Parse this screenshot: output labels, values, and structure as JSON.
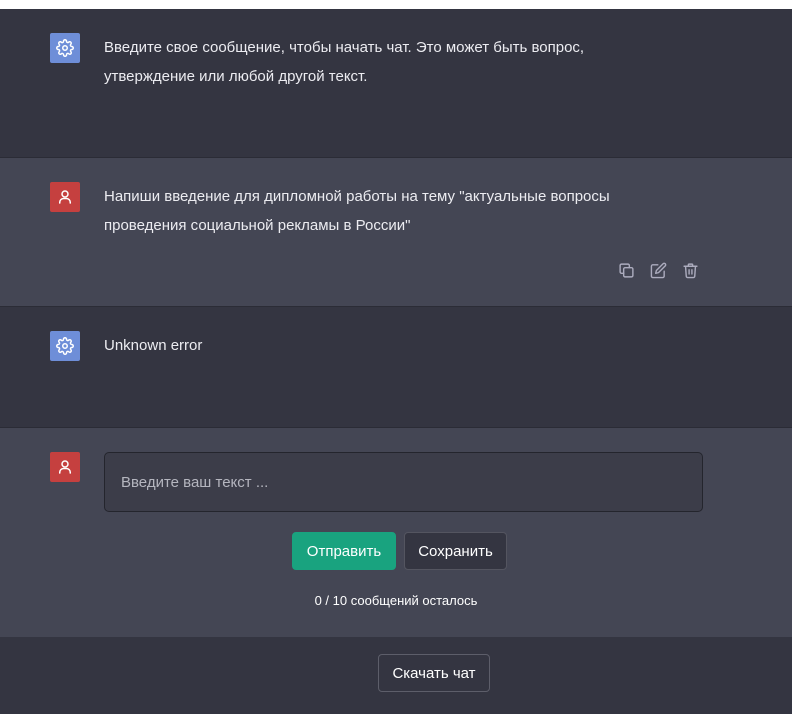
{
  "messages": [
    {
      "role": "bot",
      "icon": "gear-icon",
      "lines": [
        "Введите свое сообщение, чтобы начать чат. Это может быть вопрос,",
        "утверждение или любой другой текст."
      ]
    },
    {
      "role": "user",
      "icon": "user-icon",
      "lines": [
        "Напиши введение для дипломной работы на тему \"актуальные вопросы",
        "проведения социальной рекламы в России\""
      ],
      "actions": [
        "copy-icon",
        "edit-icon",
        "trash-icon"
      ]
    },
    {
      "role": "bot",
      "icon": "gear-icon",
      "lines": [
        "Unknown error"
      ]
    }
  ],
  "composer": {
    "placeholder": "Введите ваш текст ...",
    "value": "",
    "send_label": "Отправить",
    "save_label": "Сохранить",
    "counter": "0 / 10 сообщений осталось"
  },
  "footer": {
    "download_label": "Скачать чат"
  },
  "colors": {
    "dark_row": "#343541",
    "light_row": "#444654",
    "bot_avatar": "#6e8ed8",
    "user_avatar": "#c5403f",
    "send_button": "#19a37f"
  }
}
